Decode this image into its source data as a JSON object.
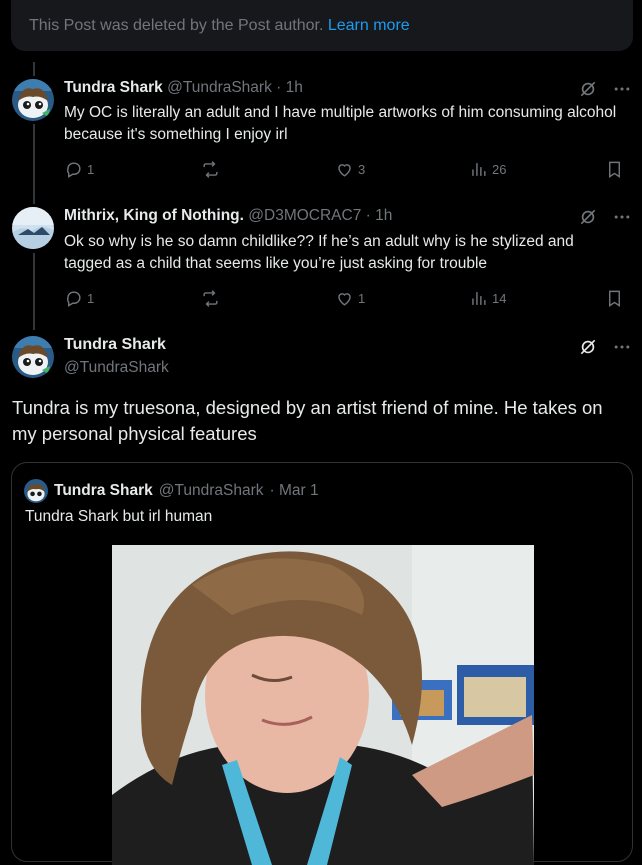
{
  "deleted_notice": {
    "text": "This Post was deleted by the Post author.",
    "link": "Learn more"
  },
  "reply1": {
    "name": "Tundra Shark",
    "handle": "@TundraShark",
    "time": "· 1h",
    "text": "My OC is literally an adult and I have multiple artworks of him consuming alcohol because it's something I enjoy irl",
    "replies": "1",
    "reposts": "",
    "likes": "3",
    "views": "26"
  },
  "reply2": {
    "name": "Mithrix, King of Nothing.",
    "handle": "@D3MOCRAC7",
    "time": "· 1h",
    "text": "Ok so why is he so damn childlike?? If he’s an adult why is he stylized and tagged as a child that seems like you’re just asking for trouble",
    "replies": "1",
    "reposts": "",
    "likes": "1",
    "views": "14"
  },
  "main_post": {
    "name": "Tundra Shark",
    "handle": "@TundraShark",
    "text": "Tundra is my truesona, designed by an artist friend of mine. He takes on my personal physical features"
  },
  "quote": {
    "name": "Tundra Shark",
    "handle": "@TundraShark",
    "time": "· Mar 1",
    "text": "Tundra Shark but irl human"
  },
  "colors": {
    "accent": "#1d9bf0",
    "muted": "#71767b",
    "text": "#e7e9ea",
    "bg": "#000000"
  }
}
